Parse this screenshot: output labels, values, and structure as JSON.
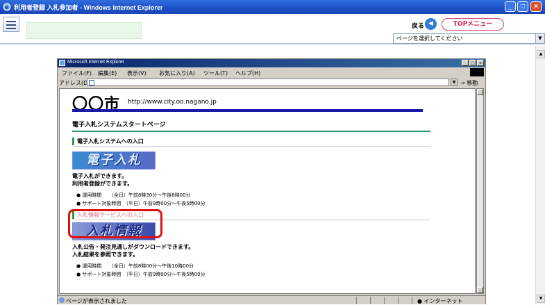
{
  "window": {
    "title": "利用者登録 入札参加者 - Windows Internet Explorer",
    "minimize": "_",
    "maximize": "□",
    "close": "×"
  },
  "toolbar": {
    "back_label": "戻る",
    "back_icon": "◀",
    "top_menu_label": "TOPメニュー",
    "page_select_value": "ページを選択してください",
    "select_arrow": "▼"
  },
  "inner_window": {
    "title": "Microsoft Internet Explorer",
    "buttons": [
      "_",
      "□",
      "×"
    ],
    "menu": [
      "ファイル(F)",
      "編集(E)",
      "表示(V)",
      "お気に入り(A)",
      "ツール(T)",
      "ヘルプ(H)"
    ],
    "address_label": "アドレス(D)",
    "go_label": "移動",
    "status_message": "ページが表示されました",
    "status_zone": "インターネット"
  },
  "page": {
    "city_name": "〇〇市",
    "city_url": "http://www.city.oo.nagano.jp",
    "system_title": "電子入札システムスタートページ",
    "section1": {
      "heading": "電子入札システムへの入口",
      "banner": "電子入札",
      "desc1": "電子入札ができます。",
      "desc2": "利用者登録ができます。",
      "bullets": [
        "運用時間　　（全日）午前8時30分～午後8時00分",
        "サポート対象時間　（平日）午前9時00分～午後5時00分"
      ]
    },
    "section2": {
      "heading": "入札情報サービスへの入口",
      "banner": "入札情報",
      "desc1": "入札公告・発注見通しがダウンロードできます。",
      "desc2": "入札結果を参照できます。",
      "bullets": [
        "運用時間　　（全日）午前8時00分～午後10時00分",
        "サポート対象時間　（平日）午前9時00分～午後5時00分"
      ]
    }
  },
  "colors": {
    "titlebar": "#1d4fc4",
    "highlight": "#e01010",
    "accent_blue": "#1a1aaa",
    "section_green": "#2a9a4a"
  }
}
